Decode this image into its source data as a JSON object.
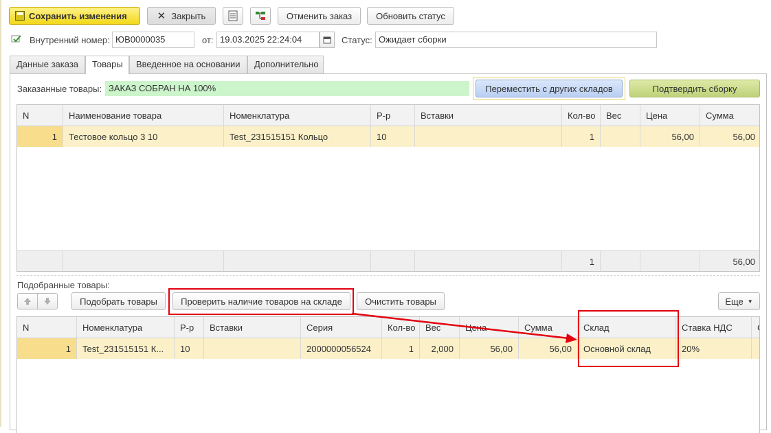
{
  "toolbar": {
    "save_label": "Сохранить изменения",
    "close_label": "Закрыть",
    "cancel_order_label": "Отменить заказ",
    "update_status_label": "Обновить статус"
  },
  "header": {
    "internal_number_label": "Внутренний номер:",
    "internal_number_value": "ЮВ0000035",
    "date_label": "от:",
    "date_value": "19.03.2025 22:24:04",
    "status_label": "Статус:",
    "status_value": "Ожидает сборки"
  },
  "tabs": [
    {
      "label": "Данные заказа"
    },
    {
      "label": "Товары"
    },
    {
      "label": "Введенное на основании"
    },
    {
      "label": "Дополнительно"
    }
  ],
  "ordered": {
    "label": "Заказанные товары:",
    "status_text": "ЗАКАЗ СОБРАН НА 100%",
    "move_button": "Переместить с других складов",
    "confirm_button": "Подтвердить сборку",
    "columns": [
      "N",
      "Наименование товара",
      "Номенклатура",
      "Р-р",
      "Вставки",
      "Кол-во",
      "Вес",
      "Цена",
      "Сумма"
    ],
    "rows": [
      [
        "1",
        "Тестовое кольцо 3 10",
        "Test_231515151 Кольцо",
        "10",
        "",
        "1",
        "",
        "56,00",
        "56,00"
      ]
    ],
    "totals": {
      "qty": "1",
      "sum": "56,00"
    }
  },
  "picked": {
    "label": "Подобранные товары:",
    "pick_button": "Подобрать товары",
    "check_button": "Проверить наличие товаров на складе",
    "clear_button": "Очистить товары",
    "more_button": "Еще",
    "columns": [
      "N",
      "Номенклатура",
      "Р-р",
      "Вставки",
      "Серия",
      "Кол-во",
      "Вес",
      "Цена",
      "Сумма",
      "Склад",
      "Ставка НДС",
      "С"
    ],
    "rows": [
      [
        "1",
        "Test_231515151 К...",
        "10",
        "",
        "2000000056524",
        "1",
        "2,000",
        "56,00",
        "56,00",
        "Основной склад",
        "20%",
        ""
      ]
    ]
  },
  "colors": {
    "save_button": "#f2d81a",
    "status_highlight": "#ccf5cc",
    "selected_row": "#fbf0c8",
    "annotation_red": "#e3000f"
  }
}
